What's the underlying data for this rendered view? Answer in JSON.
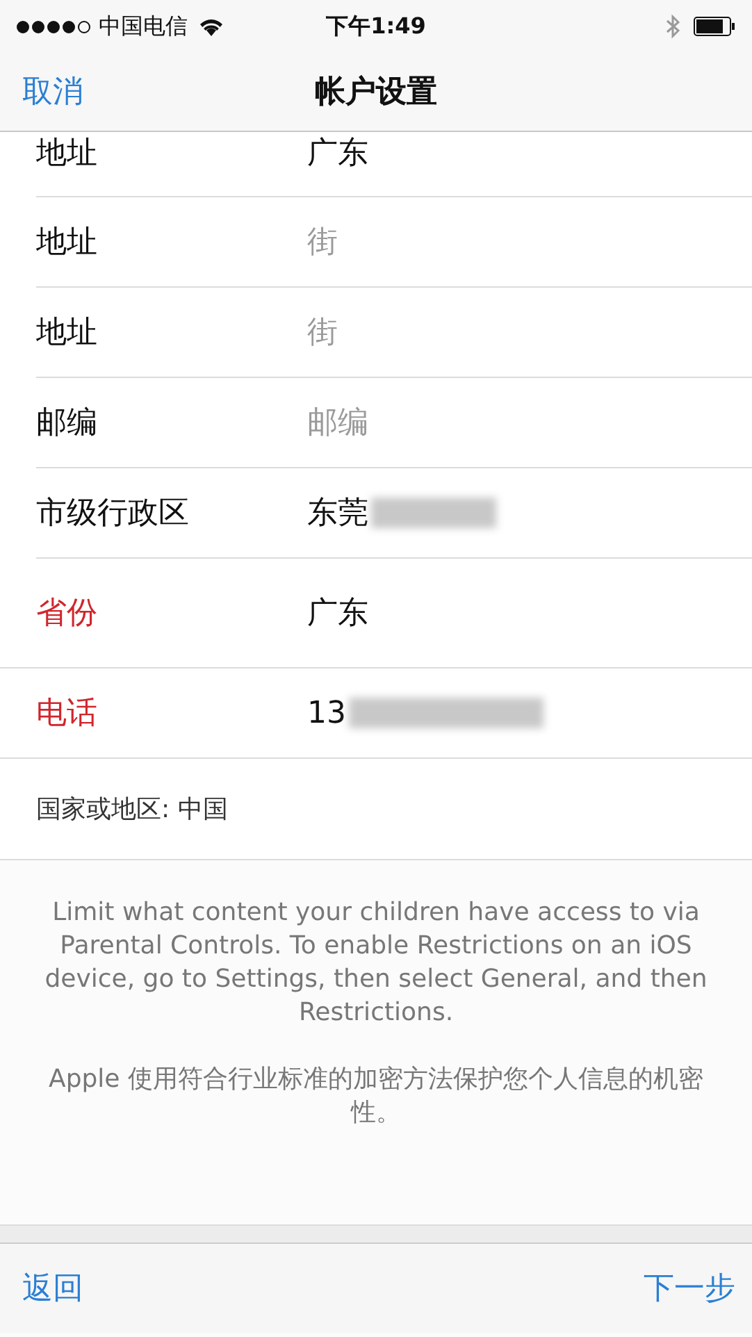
{
  "status_bar": {
    "signal_dots": [
      {
        "filled": true
      },
      {
        "filled": true
      },
      {
        "filled": true
      },
      {
        "filled": true
      },
      {
        "filled": false
      }
    ],
    "carrier": "中国电信",
    "time": "下午1:49"
  },
  "nav_bar": {
    "left_button": "取消",
    "title": "帐户设置"
  },
  "fields": [
    {
      "label": "地址",
      "value": "广东",
      "required": false,
      "cut_top": true
    },
    {
      "label": "地址",
      "placeholder": "街",
      "required": false,
      "cut_top": false
    },
    {
      "label": "地址",
      "placeholder": "街",
      "required": false,
      "cut_top": false
    },
    {
      "label": "邮编",
      "placeholder": "邮编",
      "required": false,
      "cut_top": false
    },
    {
      "label": "市级行政区",
      "value": "东莞",
      "required": false,
      "redacted": true,
      "cut_top": false
    },
    {
      "label": "省份",
      "value": "广东",
      "required": true,
      "cut_top": false
    },
    {
      "label": "电话",
      "value": "13",
      "required": true,
      "redacted": true,
      "cut_top": false
    }
  ],
  "country": "国家或地区: 中国",
  "footer_notes": [
    "Limit what content your children have access to via Parental Controls. To enable Restrictions on an iOS device, go to Settings, then select General, and then Restrictions.",
    "Apple 使用符合行业标准的加密方法保护您个人信息的机密性。"
  ],
  "toolbar": {
    "back": "返回",
    "next": "下一步"
  }
}
